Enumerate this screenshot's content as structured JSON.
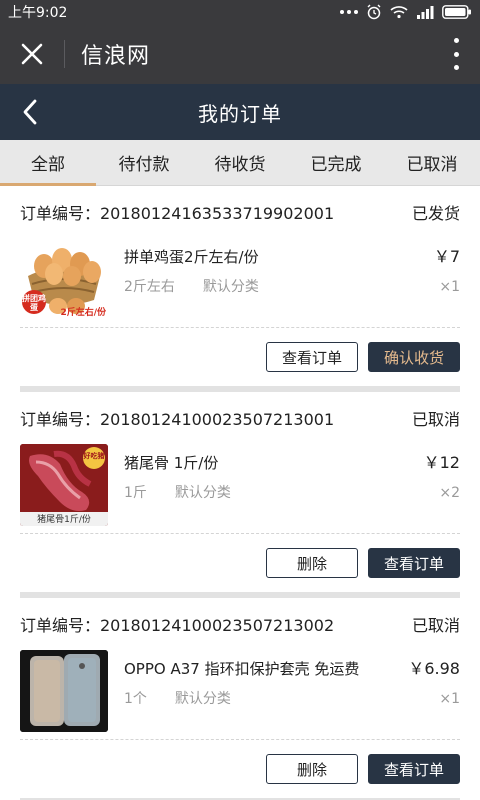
{
  "status_bar": {
    "time": "上午9:02"
  },
  "webview": {
    "title": "信浪网"
  },
  "header": {
    "title": "我的订单"
  },
  "tabs": [
    {
      "label": "全部",
      "active": true
    },
    {
      "label": "待付款",
      "active": false
    },
    {
      "label": "待收货",
      "active": false
    },
    {
      "label": "已完成",
      "active": false
    },
    {
      "label": "已取消",
      "active": false
    }
  ],
  "orders": [
    {
      "number": "订单编号：20180124163533719902001",
      "status": "已发货",
      "item": {
        "name": "拼单鸡蛋2斤左右/份",
        "spec": "2斤左右",
        "category": "默认分类",
        "price": "￥7",
        "qty": "×1"
      },
      "thumb": {
        "badge": "拼团鸡蛋",
        "caption": "2斤左右/份"
      },
      "actions": [
        "查看订单",
        "确认收货"
      ]
    },
    {
      "number": "订单编号：20180124100023507213001",
      "status": "已取消",
      "item": {
        "name": "猪尾骨 1斤/份",
        "spec": "1斤",
        "category": "默认分类",
        "price": "￥12",
        "qty": "×2"
      },
      "thumb": {
        "badge": "好吃猪",
        "caption": "猪尾骨1斤/份"
      },
      "actions": [
        "删除",
        "查看订单"
      ]
    },
    {
      "number": "订单编号：20180124100023507213002",
      "status": "已取消",
      "item": {
        "name": "OPPO A37 指环扣保护套壳 免运费",
        "spec": "1个",
        "category": "默认分类",
        "price": "￥6.98",
        "qty": "×1"
      },
      "actions": [
        "删除",
        "查看订单"
      ]
    }
  ],
  "colors": {
    "header_bg": "#283444",
    "accent": "#d9a871",
    "gold_text": "#e3b98d"
  }
}
